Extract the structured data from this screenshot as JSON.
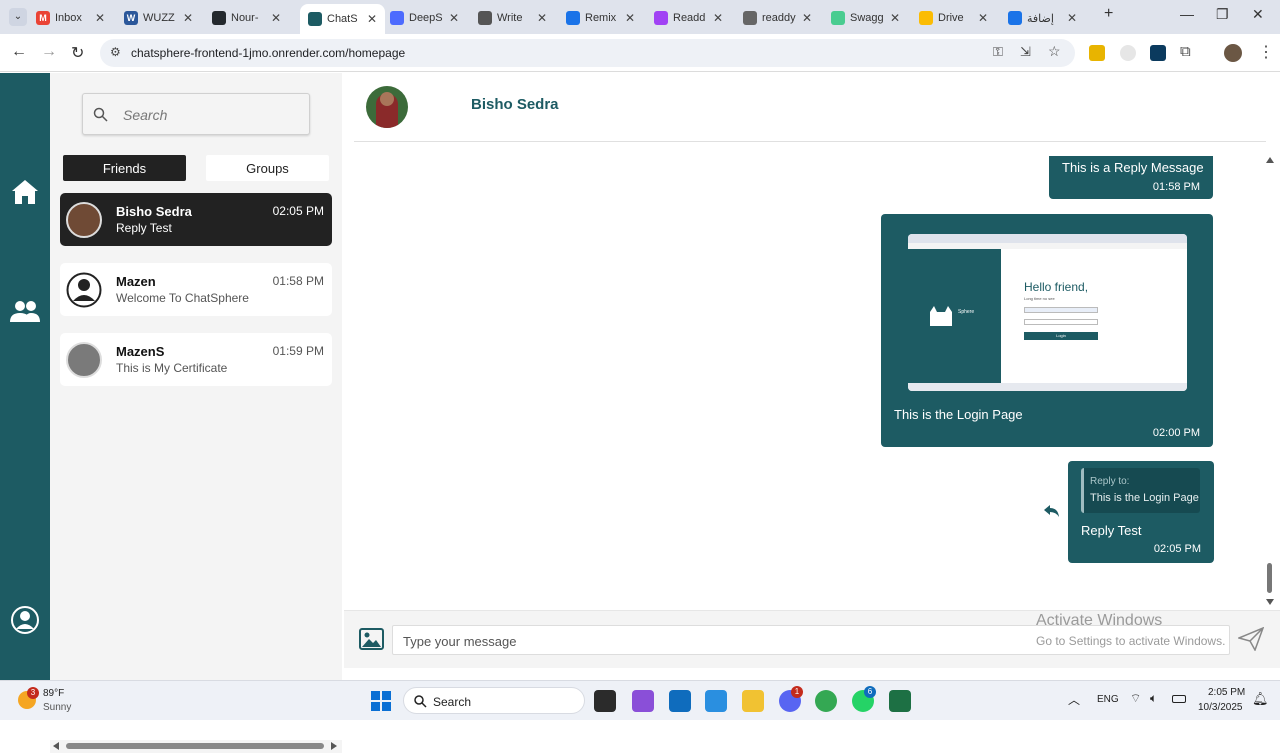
{
  "browser": {
    "tabs": [
      {
        "label": "Inbox",
        "color": "#ea4335",
        "glyph": "M"
      },
      {
        "label": "WUZZ",
        "color": "#2b579a",
        "glyph": "W"
      },
      {
        "label": "Nour-",
        "color": "#24292e",
        "glyph": ""
      },
      {
        "label": "ChatS",
        "color": "#1d5b63",
        "glyph": ""
      },
      {
        "label": "DeepS",
        "color": "#4d6bfe",
        "glyph": ""
      },
      {
        "label": "Write",
        "color": "#555555",
        "glyph": ""
      },
      {
        "label": "Remix",
        "color": "#1a73e8",
        "glyph": ""
      },
      {
        "label": "Readd",
        "color": "#a142f4",
        "glyph": ""
      },
      {
        "label": "readdy",
        "color": "#666666",
        "glyph": ""
      },
      {
        "label": "Swagg",
        "color": "#49cc90",
        "glyph": ""
      },
      {
        "label": "Drive",
        "color": "#fbbc04",
        "glyph": ""
      },
      {
        "label": "إضافة",
        "color": "#1a73e8",
        "glyph": ""
      }
    ],
    "url": "chatsphere-frontend-1jmo.onrender.com/homepage"
  },
  "sidebar": {
    "search_placeholder": "Search",
    "tabs": {
      "friends": "Friends",
      "groups": "Groups"
    },
    "chats": [
      {
        "name": "Bisho Sedra",
        "message": "Reply Test",
        "time": "02:05 PM",
        "active": true
      },
      {
        "name": "Mazen",
        "message": "Welcome To ChatSphere",
        "time": "01:58 PM",
        "active": false
      },
      {
        "name": "MazenS",
        "message": "This is My Certificate",
        "time": "01:59 PM",
        "active": false
      }
    ]
  },
  "chat": {
    "contact_name": "Bisho Sedra",
    "messages": [
      {
        "text": "This is a Reply Message",
        "time": "01:58 PM"
      },
      {
        "text": "This is the Login Page",
        "time": "02:00 PM",
        "image": {
          "heading": "Hello friend,",
          "subheading": "Long time no see",
          "brand": "Sphere",
          "login_button": "Login"
        }
      },
      {
        "reply_label": "Reply to:",
        "reply_quote": "This is the Login Page",
        "text": "Reply Test",
        "time": "02:05 PM"
      }
    ],
    "input_placeholder": "Type your message"
  },
  "watermark": {
    "activate_title": "Activate Windows",
    "activate_sub": "Go to Settings to activate Windows."
  },
  "taskbar": {
    "weather_temp": "89°F",
    "weather_desc": "Sunny",
    "weather_badge": "3",
    "search_label": "Search",
    "language": "ENG",
    "time": "2:05 PM",
    "date": "10/3/2025",
    "discord_badge": "1",
    "whatsapp_badge": "6"
  },
  "colors": {
    "brand": "#1d5b63",
    "active_chat": "#222222"
  }
}
